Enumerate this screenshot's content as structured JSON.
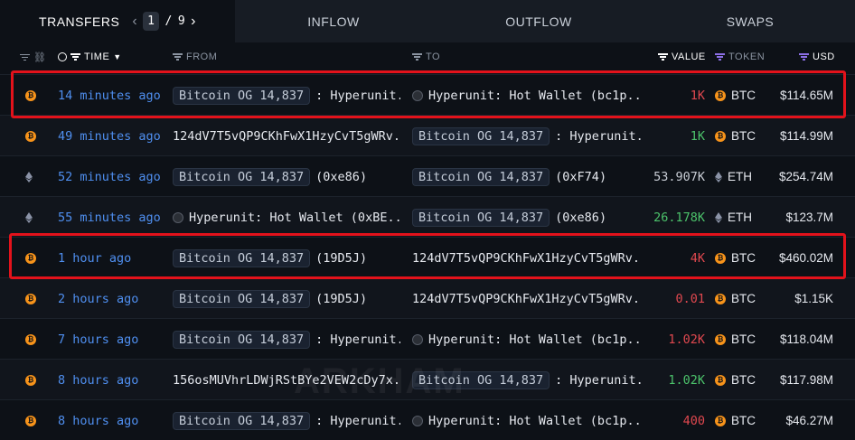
{
  "tabs": {
    "transfers": "TRANSFERS",
    "page_current": "1",
    "page_sep": "/",
    "page_total": "9",
    "inflow": "INFLOW",
    "outflow": "OUTFLOW",
    "swaps": "SWAPS"
  },
  "columns": {
    "time": "TIME",
    "from": "FROM",
    "to": "TO",
    "value": "VALUE",
    "token": "TOKEN",
    "usd": "USD"
  },
  "watermark": "ARKHAM",
  "colors": {
    "value_red": "#e0484f",
    "value_green": "#4cc36b",
    "highlight": "#e3121b",
    "btc": "#f7931a"
  },
  "rows": [
    {
      "icon": "btc-icon",
      "time": "14 minutes ago",
      "from_pill": "Bitcoin OG 14,837",
      "from_text": ": Hyperunit...",
      "to_pill": "",
      "to_icon": true,
      "to_text": "Hyperunit: Hot Wallet (bc1p...",
      "value": "1K",
      "value_color": "red",
      "token": "BTC",
      "usd": "$114.65M"
    },
    {
      "icon": "btc-icon",
      "time": "49 minutes ago",
      "from_pill": "",
      "from_text": "124dV7T5vQP9CKhFwX1HzyCvT5gWRv...",
      "to_pill": "Bitcoin OG 14,837",
      "to_icon": false,
      "to_text": ": Hyperunit...",
      "value": "1K",
      "value_color": "green",
      "token": "BTC",
      "usd": "$114.99M"
    },
    {
      "icon": "eth-icon",
      "time": "52 minutes ago",
      "from_pill": "Bitcoin OG 14,837",
      "from_text": "(0xe86)",
      "to_pill": "Bitcoin OG 14,837",
      "to_icon": false,
      "to_text": "(0xF74)",
      "value": "53.907K",
      "value_color": "gray",
      "token": "ETH",
      "usd": "$254.74M"
    },
    {
      "icon": "eth-icon",
      "time": "55 minutes ago",
      "from_pill": "",
      "from_icon": true,
      "from_text": "Hyperunit: Hot Wallet (0xBE...",
      "to_pill": "Bitcoin OG 14,837",
      "to_icon": false,
      "to_text": "(0xe86)",
      "value": "26.178K",
      "value_color": "green",
      "token": "ETH",
      "usd": "$123.7M"
    },
    {
      "icon": "btc-icon",
      "time": "1 hour ago",
      "from_pill": "Bitcoin OG 14,837",
      "from_text": "(19D5J)",
      "to_pill": "",
      "to_icon": false,
      "to_text": "124dV7T5vQP9CKhFwX1HzyCvT5gWRv...",
      "value": "4K",
      "value_color": "red",
      "token": "BTC",
      "usd": "$460.02M"
    },
    {
      "icon": "btc-icon",
      "time": "2 hours ago",
      "from_pill": "Bitcoin OG 14,837",
      "from_text": "(19D5J)",
      "to_pill": "",
      "to_icon": false,
      "to_text": "124dV7T5vQP9CKhFwX1HzyCvT5gWRv...",
      "value": "0.01",
      "value_color": "red",
      "token": "BTC",
      "usd": "$1.15K"
    },
    {
      "icon": "btc-icon",
      "time": "7 hours ago",
      "from_pill": "Bitcoin OG 14,837",
      "from_text": ": Hyperunit...",
      "to_pill": "",
      "to_icon": true,
      "to_text": "Hyperunit: Hot Wallet (bc1p...",
      "value": "1.02K",
      "value_color": "red",
      "token": "BTC",
      "usd": "$118.04M"
    },
    {
      "icon": "btc-icon",
      "time": "8 hours ago",
      "from_pill": "",
      "from_text": "156osMUVhrLDWjRStBYe2VEW2cDy7x...",
      "to_pill": "Bitcoin OG 14,837",
      "to_icon": false,
      "to_text": ": Hyperunit...",
      "value": "1.02K",
      "value_color": "green",
      "token": "BTC",
      "usd": "$117.98M"
    },
    {
      "icon": "btc-icon",
      "time": "8 hours ago",
      "from_pill": "Bitcoin OG 14,837",
      "from_text": ": Hyperunit...",
      "to_pill": "",
      "to_icon": true,
      "to_text": "Hyperunit: Hot Wallet (bc1p...",
      "value": "400",
      "value_color": "red",
      "token": "BTC",
      "usd": "$46.27M"
    }
  ]
}
